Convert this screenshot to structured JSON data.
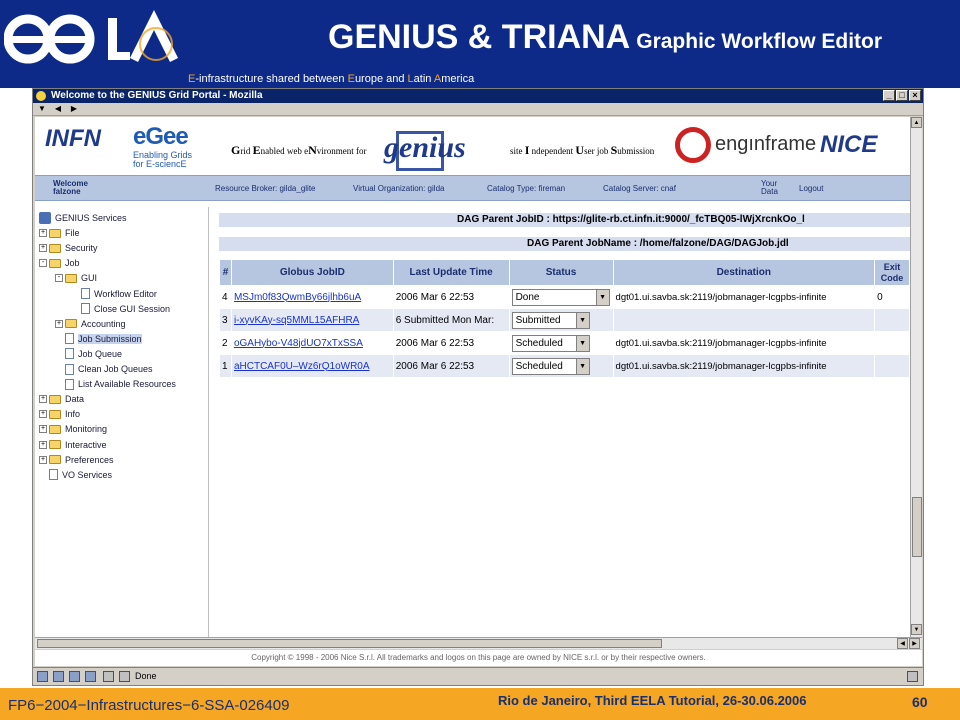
{
  "slide": {
    "title": "GENIUS & TRIANA",
    "subtitle": "Graphic Workflow Editor",
    "tagline": [
      "E",
      "-infrastructure shared between ",
      "E",
      "urope and ",
      "L",
      "atin ",
      "A",
      "merica"
    ],
    "footer_left": "FP6−2004−Infrastructures−6-SSA-026409",
    "footer_venue": "Rio de Janeiro, Third EELA Tutorial, 26-30.06.2006",
    "page_number": "60",
    "colors": {
      "header_bg": "#0d2a88",
      "footer_bg": "#f5a623",
      "accent_blue": "#b6c5e0"
    }
  },
  "browser": {
    "window_title": "Welcome to the GENIUS Grid Portal - Mozilla",
    "banner": {
      "infn": "INFN",
      "egee": "eGee",
      "egee_tagline": [
        "Enabling Grids",
        "for E-sciencE"
      ],
      "genius_desc": [
        {
          "b": "G",
          "t": "rid "
        },
        {
          "b": "E",
          "t": "nabled web e"
        },
        {
          "b": "N",
          "t": "vironment for"
        }
      ],
      "genius_logo": "genius",
      "site_desc": [
        {
          "b": "",
          "t": "site "
        },
        {
          "b": "I",
          "t": " ndependent "
        },
        {
          "b": "U",
          "t": "ser job "
        },
        {
          "b": "S",
          "t": "ubmission"
        }
      ],
      "enginframe": "engınframe",
      "nice": "NICE"
    },
    "infobar": {
      "welcome": "Welcome",
      "user": "falzone",
      "resource_broker": "Resource Broker: gilda_glite",
      "virtual_org": "Virtual Organization: gilda",
      "catalog_type": "Catalog Type: fireman",
      "catalog_server": "Catalog Server: cnaf",
      "your": "Your",
      "data": "Data",
      "logout": "Logout"
    },
    "tree": [
      {
        "label": "GENIUS Services",
        "indent": 0,
        "kind": "root"
      },
      {
        "label": "File",
        "indent": 0,
        "kind": "folder",
        "toggle": "+"
      },
      {
        "label": "Security",
        "indent": 0,
        "kind": "folder",
        "toggle": "+"
      },
      {
        "label": "Job",
        "indent": 0,
        "kind": "folder",
        "toggle": "-"
      },
      {
        "label": "GUI",
        "indent": 1,
        "kind": "folder",
        "toggle": "-"
      },
      {
        "label": "Workflow Editor",
        "indent": 2,
        "kind": "doc"
      },
      {
        "label": "Close GUI Session",
        "indent": 2,
        "kind": "doc"
      },
      {
        "label": "Accounting",
        "indent": 1,
        "kind": "folder",
        "toggle": "+"
      },
      {
        "label": "Job Submission",
        "indent": 1,
        "kind": "doc",
        "selected": true
      },
      {
        "label": "Job Queue",
        "indent": 1,
        "kind": "doc"
      },
      {
        "label": "Clean Job Queues",
        "indent": 1,
        "kind": "doc"
      },
      {
        "label": "List Available Resources",
        "indent": 1,
        "kind": "doc"
      },
      {
        "label": "Data",
        "indent": 0,
        "kind": "folder",
        "toggle": "+"
      },
      {
        "label": "Info",
        "indent": 0,
        "kind": "folder",
        "toggle": "+"
      },
      {
        "label": "Monitoring",
        "indent": 0,
        "kind": "folder",
        "toggle": "+"
      },
      {
        "label": "Interactive",
        "indent": 0,
        "kind": "folder",
        "toggle": "+"
      },
      {
        "label": "Preferences",
        "indent": 0,
        "kind": "folder",
        "toggle": "+"
      },
      {
        "label": "VO Services",
        "indent": 0,
        "kind": "doc"
      }
    ],
    "dag_parent_jobid": "DAG Parent JobID : https://glite-rb.ct.infn.it:9000/_fcTBQ05-lWjXrcnkOo_l",
    "dag_parent_jobname": "DAG Parent JobName : /home/falzone/DAG/DAGJob.jdl",
    "table": {
      "headers": [
        "#",
        "Globus JobID",
        "Last Update Time",
        "Status",
        "Destination",
        "Exit Code"
      ],
      "rows": [
        {
          "num": "4",
          "jobid": "MSJm0f83QwmBy66jlhb6uA",
          "time": "2006 Mar 6 22:53",
          "status": "Done",
          "dest": "dgt01.ui.savba.sk:2119/jobmanager-lcgpbs-infinite",
          "exit": "0"
        },
        {
          "num": "3",
          "jobid": "i-xyvKAy-sq5MML15AFHRA",
          "time": "6 Submitted Mon Mar:",
          "status": "Submitted",
          "dest": "",
          "exit": ""
        },
        {
          "num": "2",
          "jobid": "oGAHybo-V48jdUO7xTxSSA",
          "time": "2006 Mar 6 22:53",
          "status": "Scheduled",
          "dest": "dgt01.ui.savba.sk:2119/jobmanager-lcgpbs-infinite",
          "exit": ""
        },
        {
          "num": "1",
          "jobid": "aHCTCAF0U–Wz6rQ1oWR0A",
          "time": "2006 Mar 6 22:53",
          "status": "Scheduled",
          "dest": "dgt01.ui.savba.sk:2119/jobmanager-lcgpbs-infinite",
          "exit": ""
        }
      ]
    },
    "copyright": "Copyright © 1998 - 2006 Nice S.r.l. All trademarks and logos on this page are owned by NICE s.r.l. or by their respective owners.",
    "status_text": "Done"
  }
}
